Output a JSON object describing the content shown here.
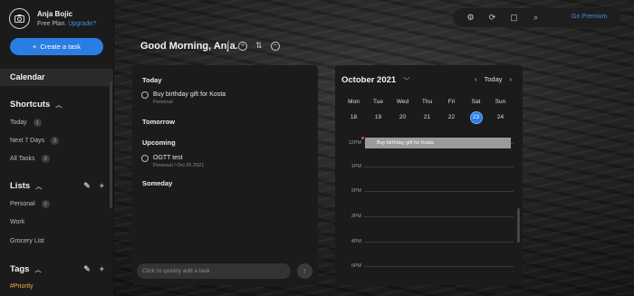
{
  "user": {
    "name": "Anja Bojic",
    "plan": "Free Plan.",
    "upgrade": "Upgrade?"
  },
  "sidebar": {
    "create_label": "Create a task",
    "calendar_label": "Calendar",
    "shortcuts": {
      "title": "Shortcuts",
      "items": [
        {
          "label": "Today",
          "count": "1"
        },
        {
          "label": "Next 7 Days",
          "count": "2"
        },
        {
          "label": "All Tasks",
          "count": "3"
        }
      ]
    },
    "lists": {
      "title": "Lists",
      "items": [
        {
          "label": "Personal",
          "count": "2"
        },
        {
          "label": "Work"
        },
        {
          "label": "Grocery List"
        }
      ]
    },
    "tags": {
      "title": "Tags",
      "items": [
        {
          "label": "#Priority"
        }
      ]
    }
  },
  "header": {
    "greeting": "Good Morning, Anja.",
    "premium": "Go Premium"
  },
  "task_list": {
    "sections": [
      "Today",
      "Tomorrow",
      "Upcoming",
      "Someday"
    ],
    "tasks": [
      {
        "title": "Buy birthday gift for Kosta",
        "sub": "Personal"
      },
      {
        "title": "OGTT test",
        "sub": "Personal  /  Oct 25 2021"
      }
    ],
    "quick_add_placeholder": "Click to quickly add a task"
  },
  "calendar": {
    "month": "October 2021",
    "today_label": "Today",
    "weekdays": [
      "Mon",
      "Tue",
      "Wed",
      "Thu",
      "Fri",
      "Sat",
      "Sun"
    ],
    "days": [
      "18",
      "19",
      "20",
      "21",
      "22",
      "23",
      "24"
    ],
    "selected_day": "23",
    "hours": [
      "12PM",
      "1PM",
      "2PM",
      "3PM",
      "4PM",
      "5PM"
    ],
    "event": "Buy birthday gift for Kosta"
  },
  "colors": {
    "accent": "#2a7ee3",
    "tag": "#e8b33b",
    "link": "#3b8fe8"
  }
}
